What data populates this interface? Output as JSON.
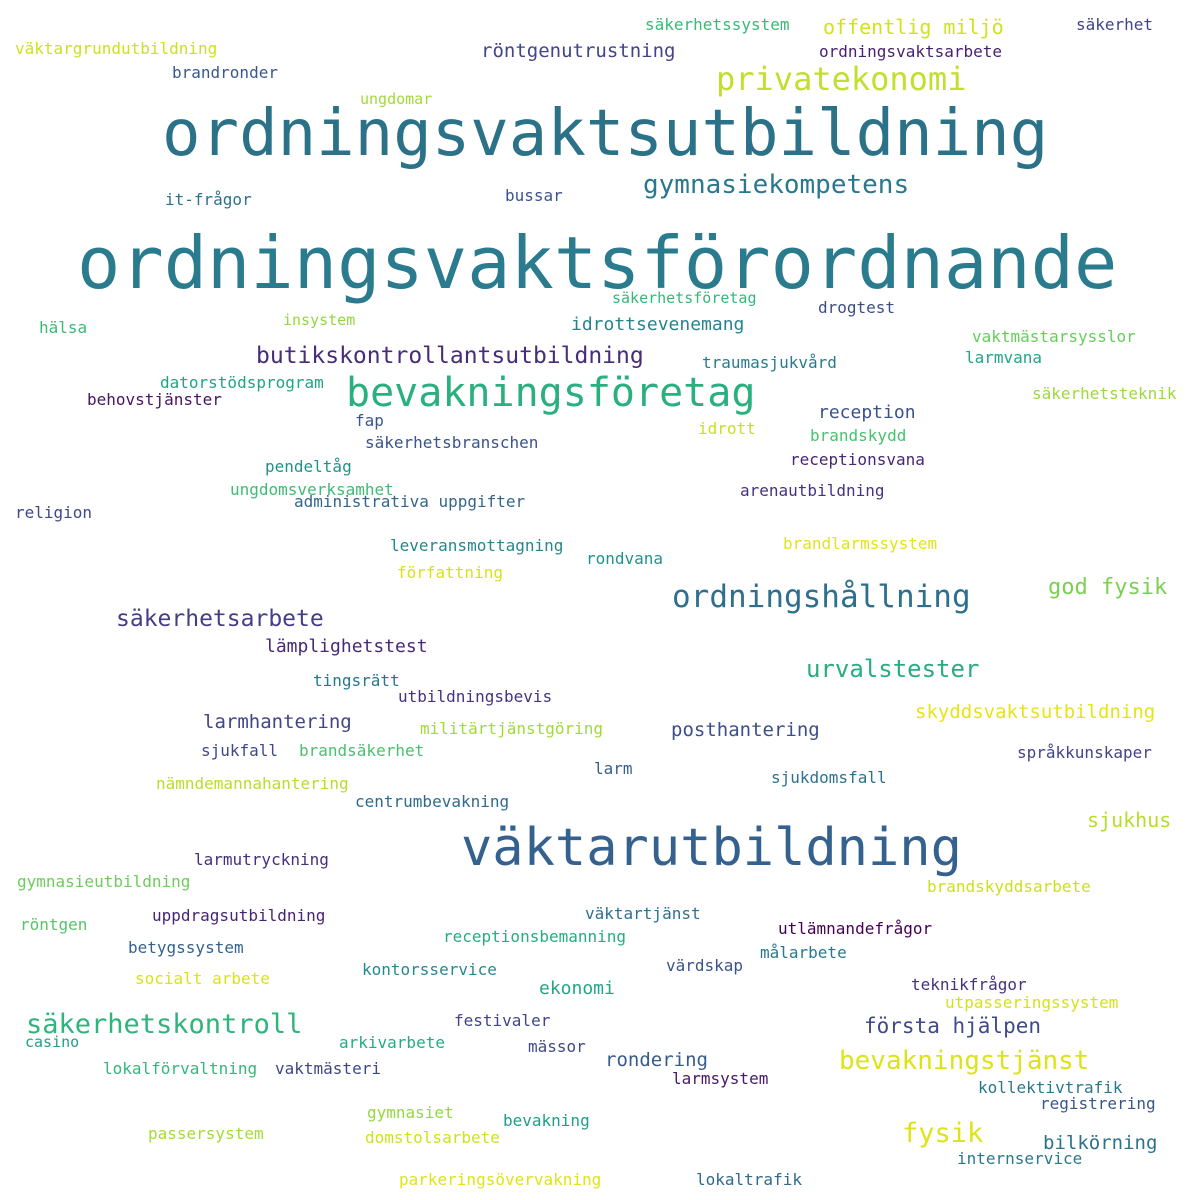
{
  "words": [
    {
      "text": "ordningsvaktsförordnande",
      "color": "#2a7b8e"
    },
    {
      "text": "ordningsvaktsutbildning",
      "color": "#2b7188"
    },
    {
      "text": "väktarutbildning",
      "color": "#34618d"
    },
    {
      "text": "bevakningsföretag",
      "color": "#2ab07f"
    },
    {
      "text": "privatekonomi",
      "color": "#c3df2e"
    },
    {
      "text": "gymnasiekompetens",
      "color": "#2a788e"
    },
    {
      "text": "ordningshållning",
      "color": "#2e6f8e"
    },
    {
      "text": "butikskontrollantsutbildning",
      "color": "#472c7a"
    },
    {
      "text": "säkerhetskontroll",
      "color": "#2fb47c"
    },
    {
      "text": "bevakningstjänst",
      "color": "#dde318"
    },
    {
      "text": "säkerhetsarbete",
      "color": "#433e85"
    },
    {
      "text": "urvalstester",
      "color": "#27ad81"
    },
    {
      "text": "fysik",
      "color": "#dde318"
    },
    {
      "text": "god fysik",
      "color": "#7ad151"
    },
    {
      "text": "första hjälpen",
      "color": "#3e4a89"
    },
    {
      "text": "sjukhus",
      "color": "#b5de2b"
    },
    {
      "text": "offentlig miljö",
      "color": "#d2e21b"
    },
    {
      "text": "röntgenutrustning",
      "color": "#414487"
    },
    {
      "text": "idrottsevenemang",
      "color": "#25848e"
    },
    {
      "text": "reception",
      "color": "#3b528b"
    },
    {
      "text": "lämplighetstest",
      "color": "#482878"
    },
    {
      "text": "larmhantering",
      "color": "#404688"
    },
    {
      "text": "posthantering",
      "color": "#3d4e8a"
    },
    {
      "text": "skyddsvaktsutbildning",
      "color": "#e5e419"
    },
    {
      "text": "rondering",
      "color": "#365c8d"
    },
    {
      "text": "bilkörning",
      "color": "#2c728e"
    },
    {
      "text": "ekonomi",
      "color": "#22a785"
    },
    {
      "text": "säkerhetssystem",
      "color": "#38b977"
    },
    {
      "text": "ordningsvaktsarbete",
      "color": "#481f70"
    },
    {
      "text": "säkerhet",
      "color": "#404588"
    },
    {
      "text": "väktargrundutbildning",
      "color": "#cde11d"
    },
    {
      "text": "brandronder",
      "color": "#38588c"
    },
    {
      "text": "ungdomar",
      "color": "#a2da37"
    },
    {
      "text": "it-frågor",
      "color": "#2d718e"
    },
    {
      "text": "bussar",
      "color": "#3a548c"
    },
    {
      "text": "säkerhetsföretag",
      "color": "#35b779"
    },
    {
      "text": "drogtest",
      "color": "#3d4d8a"
    },
    {
      "text": "hälsa",
      "color": "#3bbb75"
    },
    {
      "text": "insystem",
      "color": "#93d741"
    },
    {
      "text": "vaktmästarsysslor",
      "color": "#67cc5c"
    },
    {
      "text": "larmvana",
      "color": "#21a585"
    },
    {
      "text": "traumasjukvård",
      "color": "#297b8e"
    },
    {
      "text": "datorstödsprogram",
      "color": "#20a486"
    },
    {
      "text": "behovstjänster",
      "color": "#471365"
    },
    {
      "text": "säkerhetsteknik",
      "color": "#9dd93b"
    },
    {
      "text": "fap",
      "color": "#3a548c"
    },
    {
      "text": "idrott",
      "color": "#c8e020"
    },
    {
      "text": "brandskydd",
      "color": "#48c16e"
    },
    {
      "text": "säkerhetsbranschen",
      "color": "#3b528b"
    },
    {
      "text": "pendeltåg",
      "color": "#20928c"
    },
    {
      "text": "receptionsvana",
      "color": "#482677"
    },
    {
      "text": "ungdomsverksamhet",
      "color": "#3dbc74"
    },
    {
      "text": "administrativa uppgifter",
      "color": "#31678e"
    },
    {
      "text": "arenautbildning",
      "color": "#46327e"
    },
    {
      "text": "religion",
      "color": "#3e4989"
    },
    {
      "text": "leveransmottagning",
      "color": "#24878e"
    },
    {
      "text": "brandlarmssystem",
      "color": "#e2e418"
    },
    {
      "text": "rondvana",
      "color": "#1f948c"
    },
    {
      "text": "författning",
      "color": "#d8e219"
    },
    {
      "text": "tingsrätt",
      "color": "#2a768e"
    },
    {
      "text": "utbildningsbevis",
      "color": "#46337f"
    },
    {
      "text": "militärtjänstgöring",
      "color": "#a0da39"
    },
    {
      "text": "sjukfall",
      "color": "#3e4a89"
    },
    {
      "text": "brandsäkerhet",
      "color": "#4ac16d"
    },
    {
      "text": "språkkunskaper",
      "color": "#414487"
    },
    {
      "text": "larm",
      "color": "#355f8d"
    },
    {
      "text": "nämndemannahantering",
      "color": "#b8de29"
    },
    {
      "text": "sjukdomsfall",
      "color": "#2c718e"
    },
    {
      "text": "centrumbevakning",
      "color": "#2f6b8e"
    },
    {
      "text": "larmutryckning",
      "color": "#472f7d"
    },
    {
      "text": "gymnasieutbildning",
      "color": "#6ccd5a"
    },
    {
      "text": "brandskyddsarbete",
      "color": "#cae11f"
    },
    {
      "text": "uppdragsutbildning",
      "color": "#482475"
    },
    {
      "text": "väktartjänst",
      "color": "#2d708e"
    },
    {
      "text": "röntgen",
      "color": "#54c568"
    },
    {
      "text": "receptionsbemanning",
      "color": "#26ad81"
    },
    {
      "text": "utlämnandefrågor",
      "color": "#440154"
    },
    {
      "text": "betygssystem",
      "color": "#33638d"
    },
    {
      "text": "målarbete",
      "color": "#2a788e"
    },
    {
      "text": "socialt arbete",
      "color": "#dae319"
    },
    {
      "text": "kontorsservice",
      "color": "#23898e"
    },
    {
      "text": "värdskap",
      "color": "#3b528b"
    },
    {
      "text": "teknikfrågor",
      "color": "#46327e"
    },
    {
      "text": "utpasseringssystem",
      "color": "#d5e21a"
    },
    {
      "text": "festivaler",
      "color": "#404588"
    },
    {
      "text": "casino",
      "color": "#1fa088"
    },
    {
      "text": "arkivarbete",
      "color": "#25ac82"
    },
    {
      "text": "mässor",
      "color": "#3e4a89"
    },
    {
      "text": "lokalförvaltning",
      "color": "#35b779"
    },
    {
      "text": "vaktmästeri",
      "color": "#3f4788"
    },
    {
      "text": "larmsystem",
      "color": "#48186a"
    },
    {
      "text": "kollektivtrafik",
      "color": "#2a788e"
    },
    {
      "text": "registrering",
      "color": "#39568c"
    },
    {
      "text": "gymnasiet",
      "color": "#95d840"
    },
    {
      "text": "bevakning",
      "color": "#1f9e89"
    },
    {
      "text": "passersystem",
      "color": "#a5db36"
    },
    {
      "text": "domstolsarbete",
      "color": "#d0e11c"
    },
    {
      "text": "internservice",
      "color": "#29798e"
    },
    {
      "text": "parkeringsövervakning",
      "color": "#dfe318"
    },
    {
      "text": "lokaltrafik",
      "color": "#306a8e"
    }
  ]
}
